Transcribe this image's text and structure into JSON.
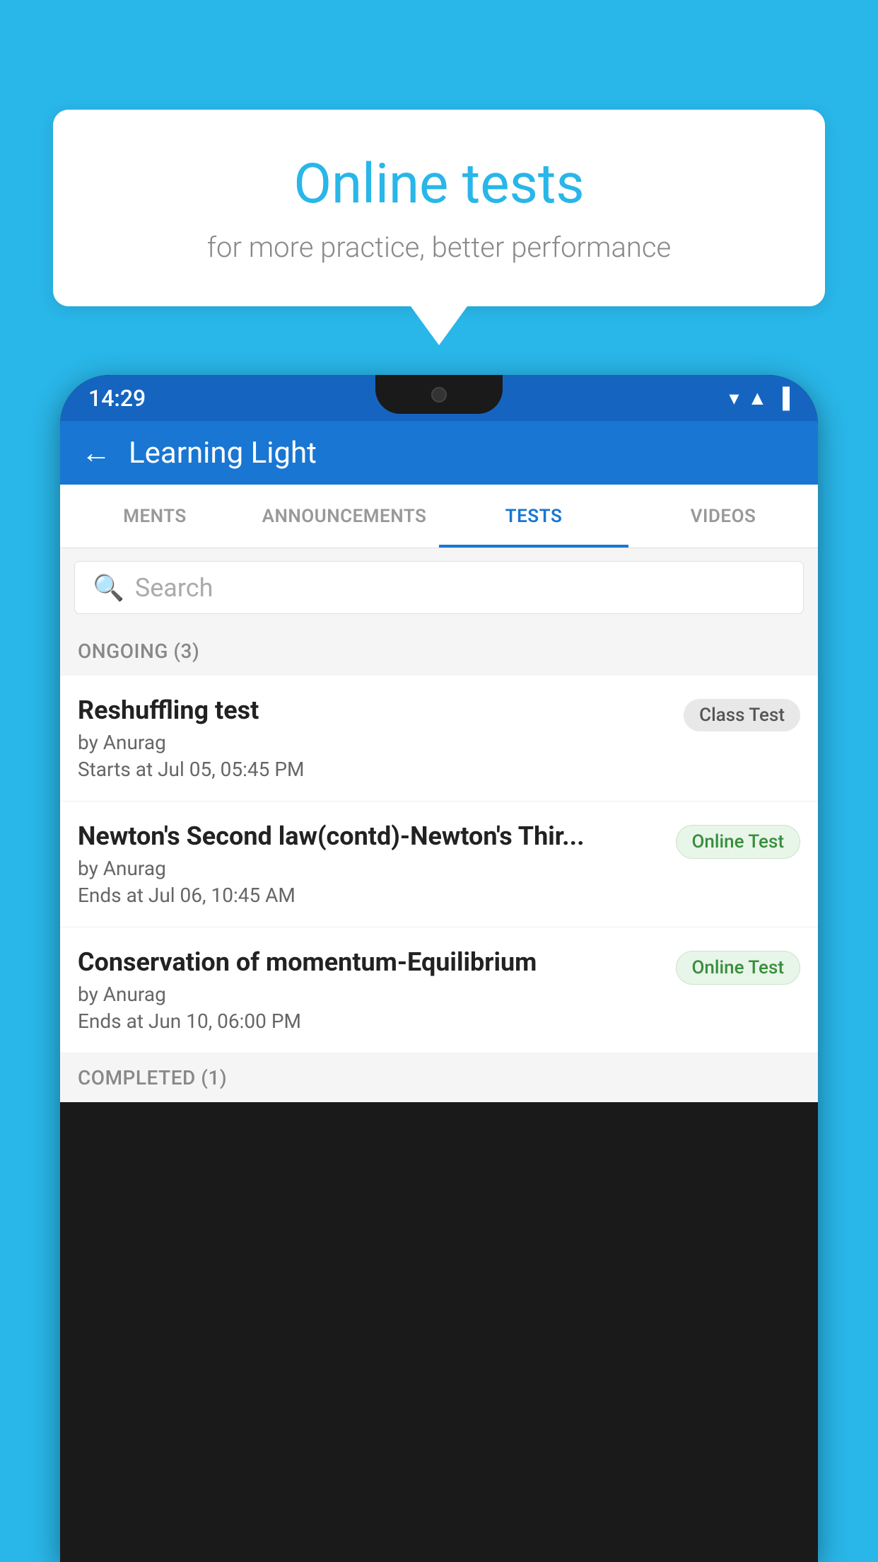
{
  "background_color": "#29B6E8",
  "speech_bubble": {
    "title": "Online tests",
    "subtitle": "for more practice, better performance"
  },
  "phone": {
    "status_bar": {
      "time": "14:29",
      "icons": [
        "▼",
        "▲",
        "▐"
      ]
    },
    "app_bar": {
      "title": "Learning Light",
      "back_label": "←"
    },
    "tabs": [
      {
        "label": "MENTS",
        "active": false
      },
      {
        "label": "ANNOUNCEMENTS",
        "active": false
      },
      {
        "label": "TESTS",
        "active": true
      },
      {
        "label": "VIDEOS",
        "active": false
      }
    ],
    "search": {
      "placeholder": "Search"
    },
    "ongoing_section": {
      "label": "ONGOING (3)"
    },
    "test_items": [
      {
        "title": "Reshuffling test",
        "author": "by Anurag",
        "date_label": "Starts at",
        "date": "Jul 05, 05:45 PM",
        "badge": "Class Test",
        "badge_type": "class"
      },
      {
        "title": "Newton's Second law(contd)-Newton's Thir...",
        "author": "by Anurag",
        "date_label": "Ends at",
        "date": "Jul 06, 10:45 AM",
        "badge": "Online Test",
        "badge_type": "online"
      },
      {
        "title": "Conservation of momentum-Equilibrium",
        "author": "by Anurag",
        "date_label": "Ends at",
        "date": "Jun 10, 06:00 PM",
        "badge": "Online Test",
        "badge_type": "online"
      }
    ],
    "completed_section": {
      "label": "COMPLETED (1)"
    }
  }
}
